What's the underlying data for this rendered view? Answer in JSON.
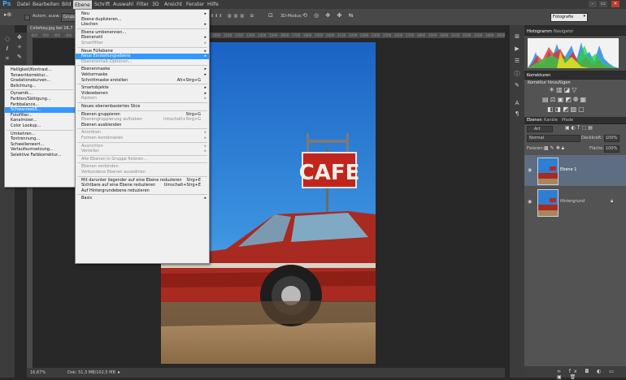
{
  "menubar": {
    "logo": "Ps",
    "items": [
      "Datei",
      "Bearbeiten",
      "Bild",
      "Ebene",
      "Schrift",
      "Auswahl",
      "Filter",
      "3D",
      "Ansicht",
      "Fenster",
      "Hilfe"
    ],
    "active_index": 3
  },
  "optionsbar": {
    "auto_select_label": "Autom. ausw.:",
    "auto_select_value": "Gruppe",
    "mode_3d": "3D-Modus:",
    "workspace": "Fotografie"
  },
  "document": {
    "tab_title": "Colorkey.jpg bei 16,7",
    "zoom": "16,67%",
    "doc_info": "Dok: 51,3 MB/102,5 MB",
    "sign_text": "CAFE"
  },
  "ruler_ticks": [
    "-600",
    "-500",
    "-400",
    "-300",
    "-200",
    "-100",
    "0",
    "100",
    "200",
    "300",
    "400",
    "500",
    "600",
    "700",
    "800",
    "900",
    "1000",
    "1100",
    "1200",
    "1300",
    "1400",
    "1500",
    "1600",
    "1700",
    "1800",
    "1900",
    "2000",
    "2100",
    "2200",
    "2300",
    "2400",
    "2500",
    "2600",
    "2700",
    "2800",
    "2900",
    "3000",
    "3100",
    "3200",
    "3300",
    "3400",
    "3500",
    "3600"
  ],
  "ebene_menu": {
    "items": [
      {
        "label": "Neu",
        "arrow": true
      },
      {
        "label": "Ebene duplizieren..."
      },
      {
        "label": "Löschen",
        "arrow": true
      },
      {
        "sep": true
      },
      {
        "label": "Ebene umbenennen..."
      },
      {
        "label": "Ebenenstil",
        "arrow": true
      },
      {
        "label": "Smartfilter",
        "arrow": true,
        "disabled": true
      },
      {
        "sep": true
      },
      {
        "label": "Neue Füllebene",
        "arrow": true
      },
      {
        "label": "Neue Einstellungsebene",
        "arrow": true,
        "highlight": true
      },
      {
        "label": "Ebeneninhalt-Optionen...",
        "disabled": true
      },
      {
        "sep": true
      },
      {
        "label": "Ebenenmaske",
        "arrow": true
      },
      {
        "label": "Vektormaske",
        "arrow": true
      },
      {
        "label": "Schnittmaske erstellen",
        "shortcut": "Alt+Strg+G"
      },
      {
        "sep": true
      },
      {
        "label": "Smartobjekte",
        "arrow": true
      },
      {
        "label": "Videoebenen",
        "arrow": true
      },
      {
        "label": "Rastern",
        "arrow": true,
        "disabled": true
      },
      {
        "sep": true
      },
      {
        "label": "Neues ebenenbasiertes Slice"
      },
      {
        "sep": true
      },
      {
        "label": "Ebenen gruppieren",
        "shortcut": "Strg+G"
      },
      {
        "label": "Ebenengruppierung aufheben",
        "shortcut": "Umschalt+Strg+G",
        "disabled": true
      },
      {
        "label": "Ebenen ausblenden"
      },
      {
        "sep": true
      },
      {
        "label": "Anordnen",
        "arrow": true,
        "disabled": true
      },
      {
        "label": "Formen kombinieren",
        "arrow": true,
        "disabled": true
      },
      {
        "sep": true
      },
      {
        "label": "Ausrichten",
        "arrow": true,
        "disabled": true
      },
      {
        "label": "Verteilen",
        "arrow": true,
        "disabled": true
      },
      {
        "sep": true
      },
      {
        "label": "Alle Ebenen in Gruppe fixieren...",
        "disabled": true
      },
      {
        "sep": true
      },
      {
        "label": "Ebenen verbinden",
        "disabled": true
      },
      {
        "label": "Verbundene Ebenen auswählen",
        "disabled": true
      },
      {
        "sep": true
      },
      {
        "label": "Mit darunter liegender auf eine Ebene reduzieren",
        "shortcut": "Strg+E"
      },
      {
        "label": "Sichtbare auf eine Ebene reduzieren",
        "shortcut": "Umschalt+Strg+E"
      },
      {
        "label": "Auf Hintergrundebene reduzieren"
      },
      {
        "sep": true
      },
      {
        "label": "Basis",
        "arrow": true
      }
    ]
  },
  "adjust_menu": {
    "items": [
      {
        "label": "Helligkeit/Kontrast..."
      },
      {
        "label": "Tonwertkorrektur..."
      },
      {
        "label": "Gradationskurven..."
      },
      {
        "label": "Belichtung..."
      },
      {
        "sep": true
      },
      {
        "label": "Dynamik..."
      },
      {
        "label": "Farbton/Sättigung..."
      },
      {
        "label": "Farbbalance..."
      },
      {
        "label": "Schwarzweiß...",
        "highlight": true
      },
      {
        "label": "Fotofilter..."
      },
      {
        "label": "Kanalmixer..."
      },
      {
        "label": "Color Lookup..."
      },
      {
        "sep": true
      },
      {
        "label": "Umkehren..."
      },
      {
        "label": "Tontrennung..."
      },
      {
        "label": "Schwellenwert..."
      },
      {
        "label": "Verlaufsumsetzung..."
      },
      {
        "label": "Selektive Farbkorrektur..."
      }
    ]
  },
  "histogram_panel": {
    "tabs": [
      "Histogramm",
      "Navigator"
    ]
  },
  "corrections_panel": {
    "tab": "Korrekturen",
    "subtitle": "Korrektur hinzufügen"
  },
  "layers_panel": {
    "tabs": [
      "Ebenen",
      "Kanäle",
      "Pfade"
    ],
    "filter": "Art",
    "blend_mode": "Normal",
    "opacity_label": "Deckkraft:",
    "opacity_value": "100%",
    "lock_label": "Fixieren:",
    "fill_label": "Fläche:",
    "fill_value": "100%",
    "layers": [
      {
        "name": "Ebene 1",
        "selected": true
      },
      {
        "name": "Hintergrund",
        "selected": false
      }
    ]
  },
  "colors": {
    "accent": "#3399ff",
    "sky": "#2d7fd1",
    "car": "#b3281f",
    "ground": "#a8865e"
  }
}
